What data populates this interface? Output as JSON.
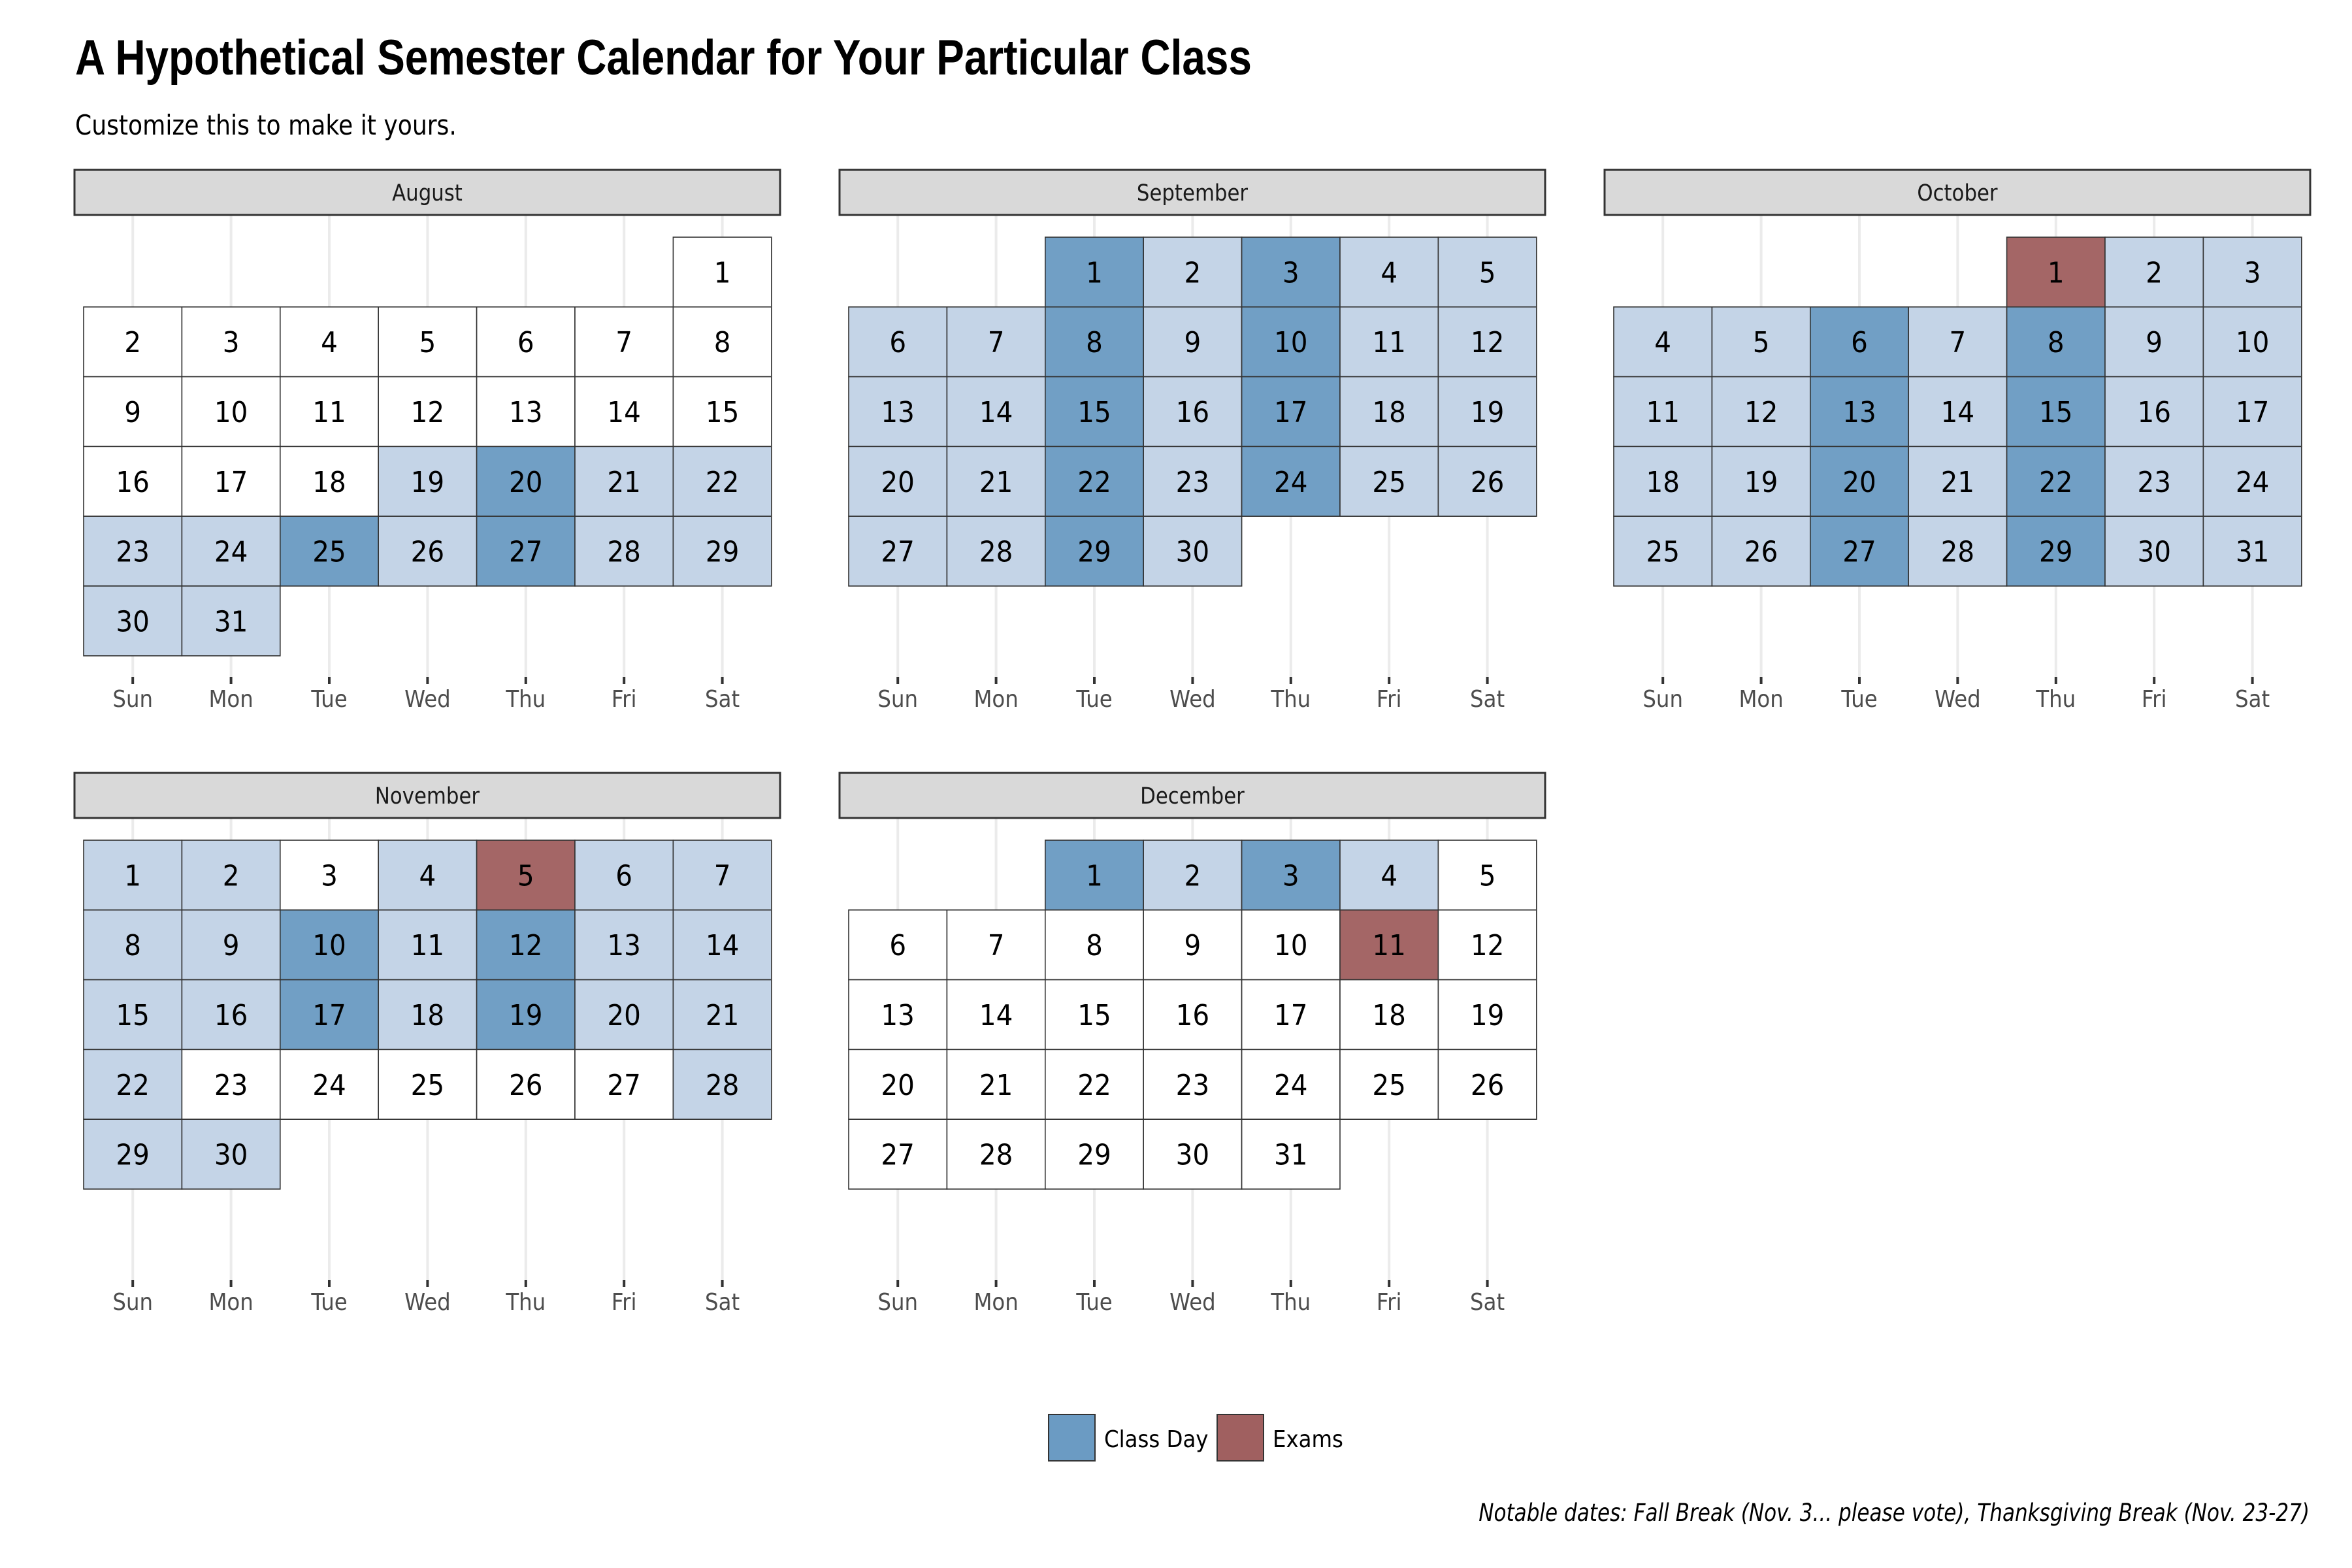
{
  "chart_data": {
    "type": "heatmap",
    "title": "A Hypothetical Semester Calendar for Your Particular Class",
    "subtitle": "Customize this to make it yours.",
    "caption": "Notable dates: Fall Break (Nov. 3... please vote), Thanksgiving Break (Nov. 23-27)",
    "weekdays": [
      "Sun",
      "Mon",
      "Tue",
      "Wed",
      "Thu",
      "Fri",
      "Sat"
    ],
    "categories": {
      "none": "#ffffff",
      "semester": "#c2d2e6",
      "class": "#6b9bc3",
      "exam": "#a06060"
    },
    "legend": [
      {
        "key": "class",
        "label": "Class Day"
      },
      {
        "key": "exam",
        "label": "Exams"
      }
    ],
    "legend_position": "bottom",
    "months": [
      {
        "name": "August",
        "first_weekday": 6,
        "days": 31,
        "semester_days": [
          19,
          20,
          21,
          22,
          23,
          24,
          25,
          26,
          27,
          28,
          29,
          30,
          31
        ],
        "class_days": [
          20,
          25,
          27
        ],
        "exam_days": []
      },
      {
        "name": "September",
        "first_weekday": 2,
        "days": 30,
        "semester_days": [
          1,
          2,
          3,
          4,
          5,
          6,
          7,
          8,
          9,
          10,
          11,
          12,
          13,
          14,
          15,
          16,
          17,
          18,
          19,
          20,
          21,
          22,
          23,
          24,
          25,
          26,
          27,
          28,
          29,
          30
        ],
        "class_days": [
          1,
          3,
          8,
          10,
          15,
          17,
          22,
          24,
          29
        ],
        "exam_days": []
      },
      {
        "name": "October",
        "first_weekday": 4,
        "days": 31,
        "semester_days": [
          1,
          2,
          3,
          4,
          5,
          6,
          7,
          8,
          9,
          10,
          11,
          12,
          13,
          14,
          15,
          16,
          17,
          18,
          19,
          20,
          21,
          22,
          23,
          24,
          25,
          26,
          27,
          28,
          29,
          30,
          31
        ],
        "class_days": [
          6,
          8,
          13,
          15,
          20,
          22,
          27,
          29
        ],
        "exam_days": [
          1
        ]
      },
      {
        "name": "November",
        "first_weekday": 0,
        "days": 30,
        "semester_days": [
          1,
          2,
          4,
          5,
          6,
          7,
          8,
          9,
          10,
          11,
          12,
          13,
          14,
          15,
          16,
          17,
          18,
          19,
          20,
          21,
          22,
          28,
          29,
          30
        ],
        "class_days": [
          10,
          12,
          17,
          19
        ],
        "exam_days": [
          5
        ]
      },
      {
        "name": "December",
        "first_weekday": 2,
        "days": 31,
        "semester_days": [
          1,
          2,
          3,
          4,
          11
        ],
        "class_days": [
          1,
          3
        ],
        "exam_days": [
          11
        ]
      }
    ]
  }
}
